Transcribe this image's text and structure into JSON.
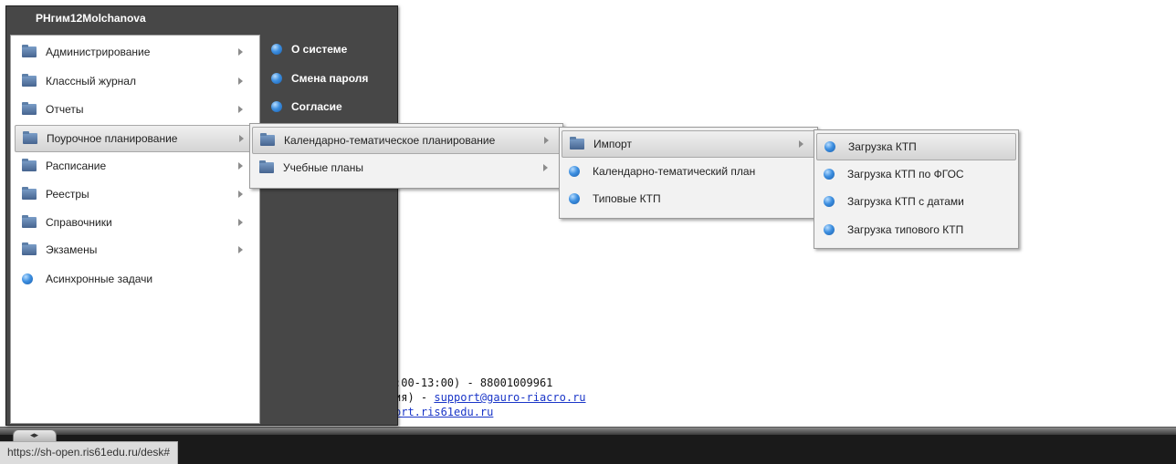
{
  "menu": {
    "title": "РНгим12Molchanova",
    "left_items": [
      {
        "label": "Администрирование",
        "icon": "folder-icon",
        "has_submenu": true
      },
      {
        "label": "Классный журнал",
        "icon": "folder-icon",
        "has_submenu": true
      },
      {
        "label": "Отчеты",
        "icon": "folder-icon",
        "has_submenu": true
      },
      {
        "label": "Поурочное планирование",
        "icon": "folder-icon",
        "has_submenu": true,
        "active": true
      },
      {
        "label": "Расписание",
        "icon": "folder-icon",
        "has_submenu": true
      },
      {
        "label": "Реестры",
        "icon": "folder-icon",
        "has_submenu": true
      },
      {
        "label": "Справочники",
        "icon": "folder-icon",
        "has_submenu": true
      },
      {
        "label": "Экзамены",
        "icon": "folder-icon",
        "has_submenu": true
      },
      {
        "label": "Асинхронные задачи",
        "icon": "blue-ball-icon",
        "has_submenu": false
      }
    ],
    "right_items": [
      {
        "label": "О системе",
        "icon": "blue-ball-icon"
      },
      {
        "label": "Смена пароля",
        "icon": "blue-ball-icon"
      },
      {
        "label": "Согласие",
        "icon": "blue-ball-icon"
      }
    ]
  },
  "submenu1": {
    "items": [
      {
        "label": "Календарно-тематическое планирование",
        "icon": "folder-icon",
        "active": true
      },
      {
        "label": "Учебные планы",
        "icon": "folder-icon"
      }
    ]
  },
  "submenu2": {
    "items": [
      {
        "label": "Импорт",
        "icon": "folder-icon",
        "active": true
      },
      {
        "label": "Календарно-тематический план",
        "icon": "blue-ball-icon"
      },
      {
        "label": "Типовые КТП",
        "icon": "blue-ball-icon"
      }
    ]
  },
  "submenu3": {
    "items": [
      {
        "label": "Загрузка КТП",
        "icon": "blue-ball-icon",
        "active": true
      },
      {
        "label": "Загрузка КТП по ФГОС",
        "icon": "blue-ball-icon"
      },
      {
        "label": "Загрузка КТП с датами",
        "icon": "blue-ball-icon"
      },
      {
        "label": "Загрузка типового КТП",
        "icon": "blue-ball-icon"
      }
    ]
  },
  "contact": {
    "line1": ":00-13:00) - 88001009961",
    "line2_prefix": "ия) - ",
    "line2_email": "support@gauro-riacro.ru",
    "line3_link": "ort.ris61edu.ru"
  },
  "status_url": "https://sh-open.ris61edu.ru/desk#",
  "taskbar": {
    "start_label": "◂▸"
  },
  "colors": {
    "menu_bg": "#474747",
    "highlight": "#d4d4d4",
    "link": "#1a36c8",
    "taskbar": "#1a1a1a"
  }
}
